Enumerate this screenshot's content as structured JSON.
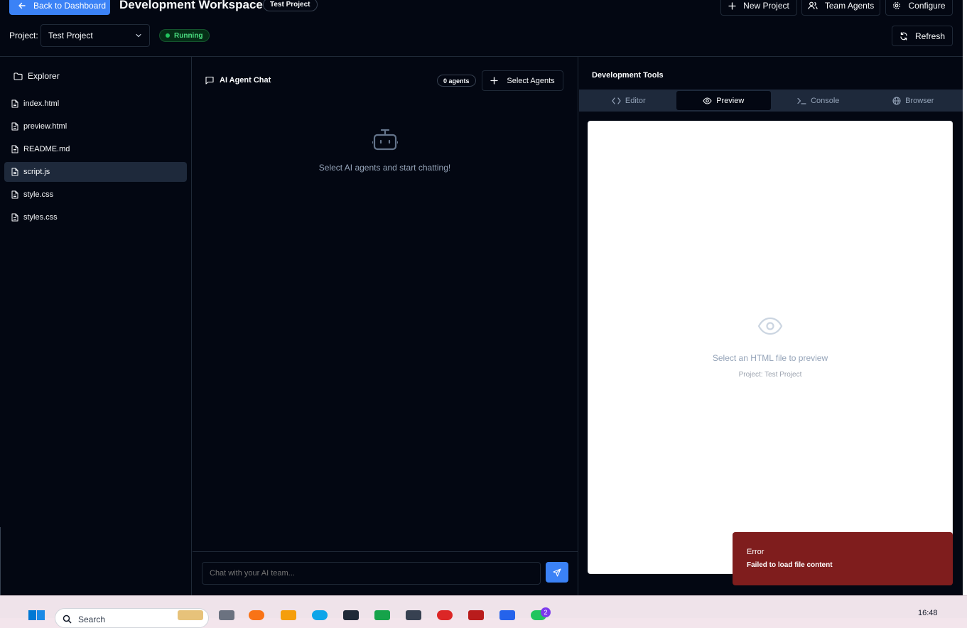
{
  "header": {
    "back_label": "Back to Dashboard",
    "title": "Development Workspace",
    "project_badge": "Test Project",
    "new_project": "New Project",
    "team_agents": "Team Agents",
    "configure": "Configure",
    "project_label": "Project:",
    "project_value": "Test Project",
    "status": "Running",
    "refresh": "Refresh"
  },
  "explorer": {
    "title": "Explorer",
    "files": [
      "index.html",
      "preview.html",
      "README.md",
      "script.js",
      "style.css",
      "styles.css"
    ],
    "selected": "script.js"
  },
  "chat": {
    "title": "AI Agent Chat",
    "agents_count": "0 agents",
    "select_agents": "Select Agents",
    "empty_message": "Select AI agents and start chatting!",
    "input_placeholder": "Chat with your AI team..."
  },
  "dev_tools": {
    "title": "Development Tools",
    "tabs": [
      "Editor",
      "Preview",
      "Console",
      "Browser"
    ],
    "active_tab": "Preview",
    "preview_message": "Select an HTML file to preview",
    "preview_project": "Project: Test Project"
  },
  "toast": {
    "title": "Error",
    "message": "Failed to load file content"
  },
  "taskbar": {
    "search_placeholder": "Search",
    "time": "16:48",
    "notification_count": "2"
  },
  "colors": {
    "background": "#030712",
    "accent": "#3b82f6",
    "running": "#22c55e",
    "error": "#7f1d1d"
  }
}
